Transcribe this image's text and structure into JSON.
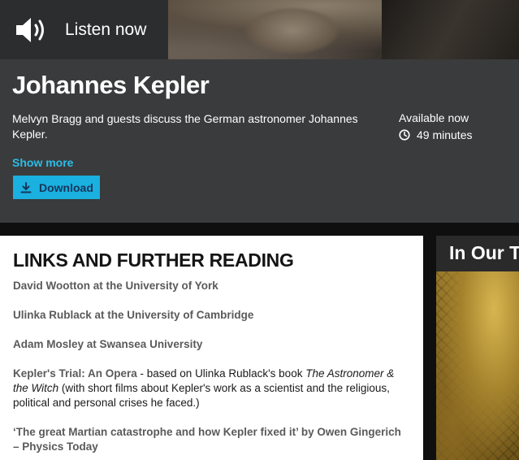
{
  "listen": {
    "label": "Listen now"
  },
  "episode": {
    "title": "Johannes Kepler",
    "description": "Melvyn Bragg and guests discuss the German astronomer Johannes Kepler.",
    "availability": "Available now",
    "duration": "49 minutes",
    "show_more": "Show more",
    "download_label": "Download"
  },
  "links_section": {
    "heading": "LINKS AND FURTHER READING",
    "items": [
      {
        "text": "David Wootton at the University of York"
      },
      {
        "text": "Ulinka Rublack at the University of Cambridge"
      },
      {
        "text": "Adam Mosley at Swansea University"
      },
      {
        "link": "Kepler's Trial: An Opera",
        "rest1": " - based on Ulinka Rublack's book ",
        "book": "The Astronomer & the Witch",
        "rest2": " (with short films about Kepler's work as a scientist and the religious, political and personal crises he faced.)"
      },
      {
        "text": "‘The great Martian catastrophe and how Kepler fixed it’ by Owen Gingerich – Physics Today"
      }
    ]
  },
  "side_promo": {
    "title": "In Our T"
  },
  "colors": {
    "accent": "#1ab0e0",
    "panel": "#3a3b3c",
    "link": "#5a5a5a"
  },
  "icons": {
    "listen": "speaker-icon",
    "duration": "clock-icon",
    "download": "download-icon"
  }
}
